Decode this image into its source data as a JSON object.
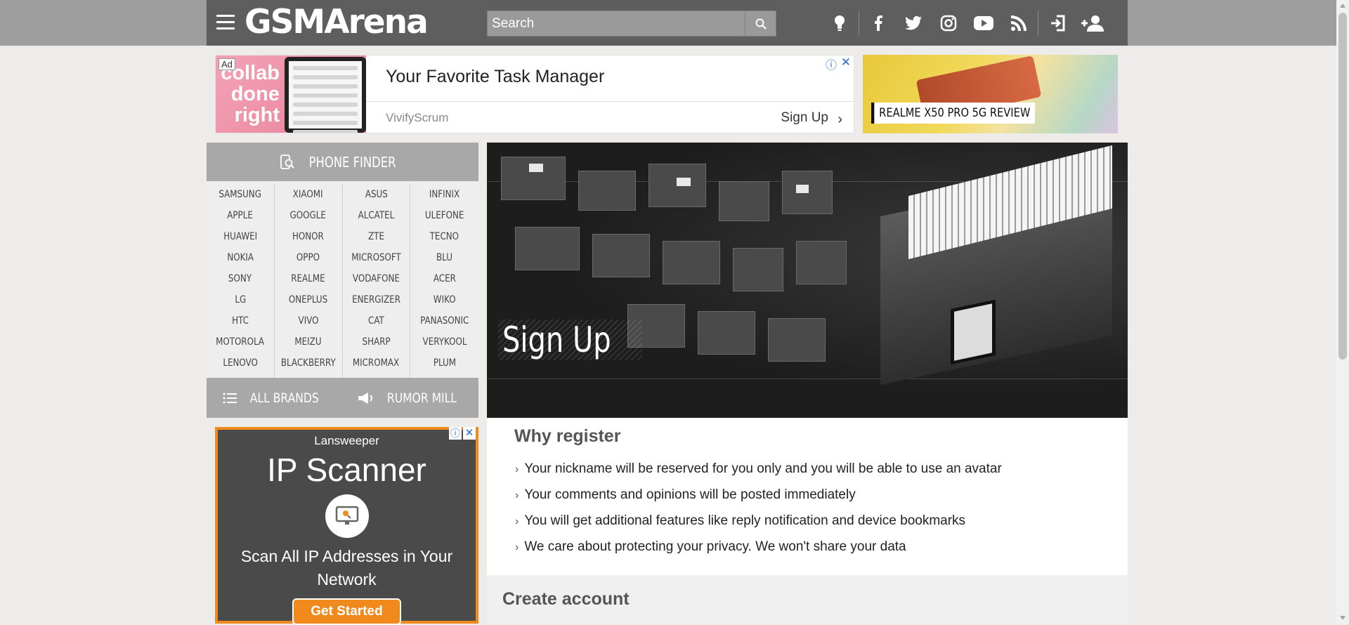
{
  "header": {
    "logo": "GSMArena",
    "search_placeholder": "Search",
    "icons": [
      "tip-icon",
      "facebook-icon",
      "twitter-icon",
      "instagram-icon",
      "youtube-icon",
      "rss-icon",
      "login-icon",
      "add-user-icon"
    ]
  },
  "ad_top": {
    "badge": "Ad",
    "image_text": "collab done right",
    "title": "Your Favorite Task Manager",
    "advertiser": "VivifyScrum",
    "cta": "Sign Up"
  },
  "review_banner": {
    "label": "REALME X50 PRO 5G REVIEW"
  },
  "phone_finder": {
    "title": "PHONE FINDER",
    "columns": [
      [
        "SAMSUNG",
        "APPLE",
        "HUAWEI",
        "NOKIA",
        "SONY",
        "LG",
        "HTC",
        "MOTOROLA",
        "LENOVO"
      ],
      [
        "XIAOMI",
        "GOOGLE",
        "HONOR",
        "OPPO",
        "REALME",
        "ONEPLUS",
        "VIVO",
        "MEIZU",
        "BLACKBERRY"
      ],
      [
        "ASUS",
        "ALCATEL",
        "ZTE",
        "MICROSOFT",
        "VODAFONE",
        "ENERGIZER",
        "CAT",
        "SHARP",
        "MICROMAX"
      ],
      [
        "INFINIX",
        "ULEFONE",
        "TECNO",
        "BLU",
        "ACER",
        "WIKO",
        "PANASONIC",
        "VERYKOOL",
        "PLUM"
      ]
    ],
    "all_brands": "ALL BRANDS",
    "rumor_mill": "RUMOR MILL"
  },
  "side_ad": {
    "brand": "Lansweeper",
    "headline": "IP Scanner",
    "description": "Scan All IP Addresses in Your Network",
    "cta": "Get Started"
  },
  "main": {
    "hero_title": "Sign Up",
    "why_title": "Why register",
    "benefits": [
      "Your nickname will be reserved for you only and you will be able to use an avatar",
      "Your comments and opinions will be posted immediately",
      "You will get additional features like reply notification and device bookmarks",
      "We care about protecting your privacy. We won't share your data"
    ],
    "create_title": "Create account"
  },
  "colors": {
    "header": "#5e5e5e",
    "topbar": "#9e9e9e",
    "panel": "#a8a8a8",
    "ad_orange": "#f08a1c"
  }
}
